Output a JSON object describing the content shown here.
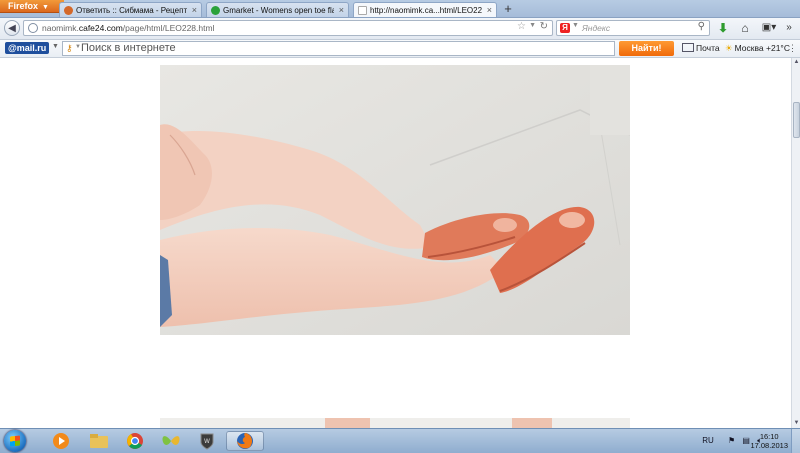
{
  "browser": {
    "menu_label": "Firefox",
    "tabs": [
      {
        "label": "Ответить :: Сибмама - Рецепт хорош...",
        "active": false,
        "icon_color": "#d4682a"
      },
      {
        "label": "Gmarket - Womens open toe flat sho...",
        "active": false,
        "icon_color": "#2aa23a"
      },
      {
        "label": "http://naomimk.ca...html/LEO228.html",
        "active": true,
        "icon_color": "#ffffff"
      }
    ],
    "tab_close": "×",
    "new_tab": "+",
    "url_prefix": "naomimk.",
    "url_domain": "cafe24.com",
    "url_path": "/page/html/LEO228.html",
    "search_engine_placeholder": "Яндекс"
  },
  "mailru_bar": {
    "logo": "@mail.ru",
    "search_placeholder": "Поиск в интернете",
    "search_button": "Найти!",
    "mail_label": "Почта",
    "weather": "Москва +21°C"
  },
  "taskbar": {
    "language": "RU",
    "time": "16:10",
    "date": "17.08.2013"
  },
  "colors": {
    "accent_orange": "#f47a15",
    "mailru_blue": "#1f4f9d",
    "sandal": "#e07a5a"
  }
}
